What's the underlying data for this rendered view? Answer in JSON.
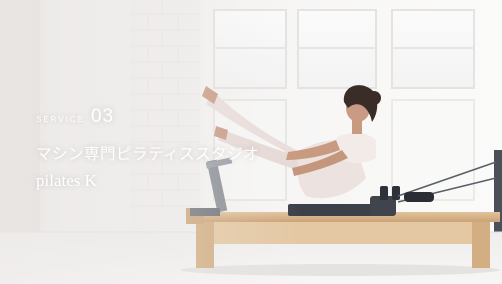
{
  "service": {
    "label": "SERVICE",
    "number": "03",
    "title_jp": "マシン専門ピラティススタジオ",
    "title_en": "pilates K"
  },
  "photo": {
    "subject": "woman-on-pilates-reformer"
  },
  "colors": {
    "text": "#ffffff",
    "wall": "#f4f3f2",
    "floor": "#ecebea",
    "reformer_wood": "#d9b78d",
    "reformer_pad": "#3b4049"
  }
}
